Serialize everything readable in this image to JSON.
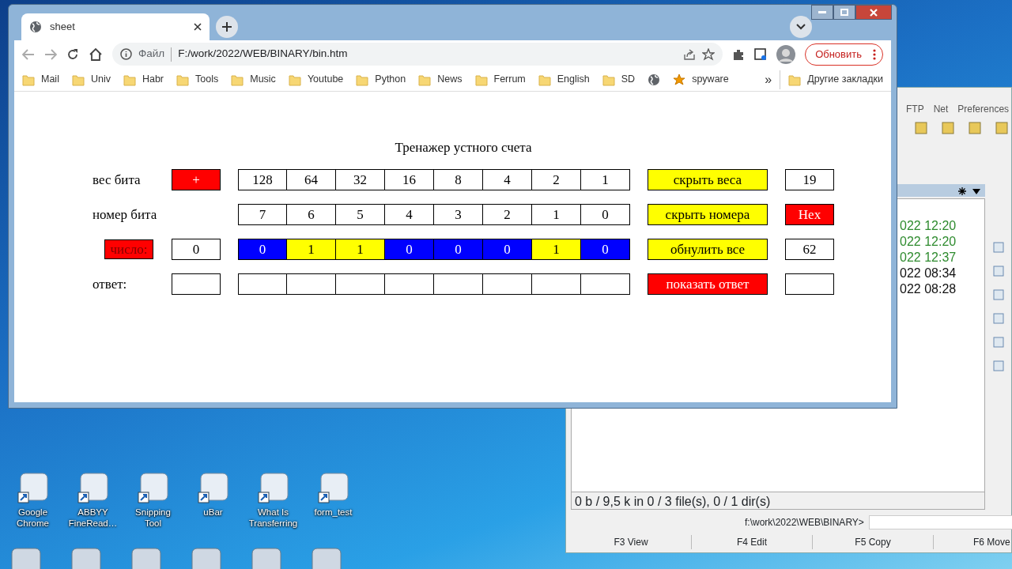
{
  "browser": {
    "tab": {
      "title": "sheet"
    },
    "address": {
      "scheme_label": "Файл",
      "url": "F:/work/2022/WEB/BINARY/bin.htm"
    },
    "update_button": "Обновить",
    "bookmarks": [
      {
        "kind": "folder",
        "label": "Mail"
      },
      {
        "kind": "folder",
        "label": "Univ"
      },
      {
        "kind": "folder",
        "label": "Habr"
      },
      {
        "kind": "folder",
        "label": "Tools"
      },
      {
        "kind": "folder",
        "label": "Music"
      },
      {
        "kind": "folder",
        "label": "Youtube"
      },
      {
        "kind": "folder",
        "label": "Python"
      },
      {
        "kind": "folder",
        "label": "News"
      },
      {
        "kind": "folder",
        "label": "Ferrum"
      },
      {
        "kind": "folder",
        "label": "English"
      },
      {
        "kind": "folder",
        "label": "SD"
      },
      {
        "kind": "globe"
      },
      {
        "kind": "star",
        "label": "spyware"
      }
    ],
    "overflow": "»",
    "other_bookmarks": "Другие закладки"
  },
  "page": {
    "title": "Тренажер устного счета",
    "rows": [
      {
        "label": {
          "kind": "text",
          "text": "вес бита"
        },
        "lead": {
          "kind": "button",
          "text": "+"
        },
        "cells": [
          {
            "text": "128"
          },
          {
            "text": "64"
          },
          {
            "text": "32"
          },
          {
            "text": "16"
          },
          {
            "text": "8"
          },
          {
            "text": "4"
          },
          {
            "text": "2"
          },
          {
            "text": "1"
          }
        ],
        "action": {
          "text": "скрыть веса",
          "color": "#ffff00"
        },
        "side": {
          "kind": "field",
          "text": "19"
        }
      },
      {
        "label": {
          "kind": "text",
          "text": "номер бита"
        },
        "cells": [
          {
            "text": "7"
          },
          {
            "text": "6"
          },
          {
            "text": "5"
          },
          {
            "text": "4"
          },
          {
            "text": "3"
          },
          {
            "text": "2"
          },
          {
            "text": "1"
          },
          {
            "text": "0"
          }
        ],
        "action": {
          "text": "скрыть номера",
          "color": "#ffff00"
        },
        "side": {
          "kind": "button",
          "text": "Hex"
        }
      },
      {
        "label": {
          "kind": "button",
          "text": "число:"
        },
        "lead": {
          "kind": "field",
          "text": "0"
        },
        "cells": [
          {
            "text": "0",
            "on": false
          },
          {
            "text": "1",
            "on": true
          },
          {
            "text": "1",
            "on": true
          },
          {
            "text": "0",
            "on": false
          },
          {
            "text": "0",
            "on": false
          },
          {
            "text": "0",
            "on": false
          },
          {
            "text": "1",
            "on": true
          },
          {
            "text": "0",
            "on": false
          }
        ],
        "action": {
          "text": "обнулить все",
          "color": "#ffff00"
        },
        "side": {
          "kind": "field",
          "text": "62"
        }
      },
      {
        "label": {
          "kind": "text",
          "text": "ответ:"
        },
        "lead": {
          "kind": "field"
        },
        "cells": [
          {},
          {},
          {},
          {},
          {},
          {},
          {},
          {}
        ],
        "action": {
          "text": "показать ответ",
          "color": "#ff0000"
        },
        "side": {
          "kind": "field"
        }
      }
    ]
  },
  "file_manager": {
    "menu": [
      "FTP",
      "Net",
      "Preferences"
    ],
    "dates": [
      {
        "text": "022 12:20",
        "color": "#2e8b2e"
      },
      {
        "text": "022 12:20",
        "color": "#2e8b2e"
      },
      {
        "text": "022 12:37",
        "color": "#2e8b2e"
      },
      {
        "text": "022 08:34",
        "color": "#111111"
      },
      {
        "text": "022 08:28",
        "color": "#111111"
      }
    ],
    "status": "0 b / 9,5 k in 0 / 3 file(s), 0 / 1 dir(s)",
    "path": "f:\\work\\2022\\WEB\\BINARY>",
    "function_keys": [
      "F3 View",
      "F4 Edit",
      "F5 Copy",
      "F6 Move"
    ]
  },
  "desktop_icons": [
    {
      "label": "Google Chrome"
    },
    {
      "label": "ABBYY FineRead…"
    },
    {
      "label": "Snipping Tool"
    },
    {
      "label": "uBar"
    },
    {
      "label": "What Is Transferring"
    },
    {
      "label": "form_test"
    }
  ]
}
